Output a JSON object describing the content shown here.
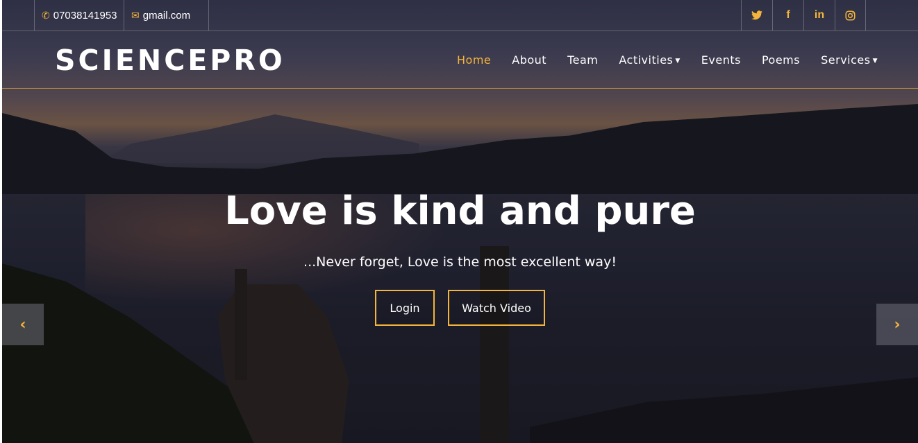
{
  "topbar": {
    "phone": "07038141953",
    "phone_icon": "phone-icon",
    "email": "gmail.com",
    "email_icon": "envelope-icon",
    "social": [
      {
        "name": "twitter-icon",
        "glyph": "🐦"
      },
      {
        "name": "facebook-icon",
        "glyph": "f"
      },
      {
        "name": "linkedin-icon",
        "glyph": "in"
      },
      {
        "name": "instagram-icon",
        "glyph": "◎"
      }
    ]
  },
  "nav": {
    "brand": "SCIENCEPRO",
    "items": [
      {
        "label": "Home",
        "active": true
      },
      {
        "label": "About"
      },
      {
        "label": "Team"
      },
      {
        "label": "Activities",
        "dropdown": true
      },
      {
        "label": "Events"
      },
      {
        "label": "Poems"
      },
      {
        "label": "Services",
        "dropdown": true
      }
    ]
  },
  "hero": {
    "title": "Love is kind and pure",
    "subtitle": "...Never forget, Love is the most excellent way!",
    "buttons": {
      "login": "Login",
      "video": "Watch Video"
    },
    "prev_glyph": "‹",
    "next_glyph": "›"
  },
  "colors": {
    "accent": "#f5b53a",
    "text": "#ffffff"
  }
}
